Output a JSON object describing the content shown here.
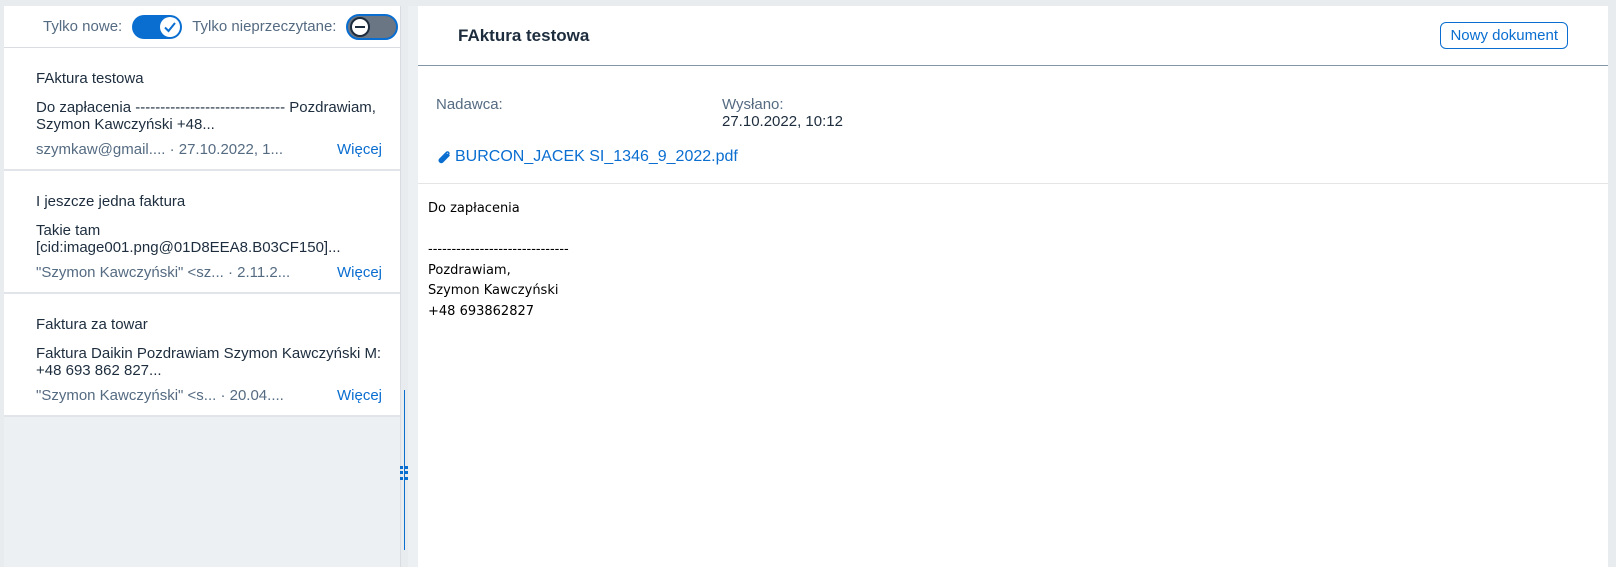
{
  "filters": {
    "only_new_label": "Tylko nowe:",
    "only_new_on": true,
    "only_unread_label": "Tylko nieprzeczytane:",
    "only_unread_on": false
  },
  "messages": [
    {
      "title": "FAktura testowa",
      "preview": "Do zapłacenia ------------------------------ Pozdrawiam, Szymon Kawczyński +48...",
      "meta": "szymkaw@gmail....  ·  27.10.2022, 1...",
      "more": "Więcej"
    },
    {
      "title": "I jeszcze jedna faktura",
      "preview": "Takie tam [cid:image001.png@01D8EEA8.B03CF150]...",
      "meta": "\"Szymon Kawczyński\" <sz...  ·  2.11.2...",
      "more": "Więcej"
    },
    {
      "title": "Faktura za towar",
      "preview": "Faktura Daikin Pozdrawiam Szymon Kawczyński M: +48 693 862 827...",
      "meta": "\"Szymon Kawczyński\" <s...  ·  20.04....",
      "more": "Więcej"
    }
  ],
  "detail": {
    "title": "FAktura testowa",
    "new_document_label": "Nowy dokument",
    "sender_label": "Nadawca:",
    "sender_value": "",
    "sent_label": "Wysłano:",
    "sent_value": "27.10.2022, 10:12",
    "attachment_name": "BURCON_JACEK SI_1346_9_2022.pdf",
    "body_lines": [
      "Do zapłacenia",
      "",
      "------------------------------",
      "Pozdrawiam,",
      "Szymon Kawczyński",
      "+48 693862827"
    ]
  },
  "colors": {
    "accent": "#0a6ed1",
    "text": "#1d2d3e",
    "muted": "#556b82"
  }
}
